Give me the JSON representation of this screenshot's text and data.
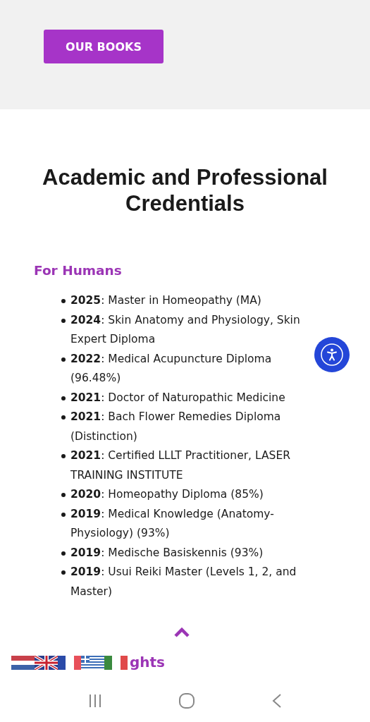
{
  "header": {
    "button": "OUR BOOKS"
  },
  "heading": "Academic and Professional Credentials",
  "section": {
    "title": "For Humans",
    "items": [
      "**2025**: Master in Homeopathy (MA)",
      "**2024**: Skin Anatomy and Physiology, Skin Expert Diploma",
      "**2022**: Medical Acupuncture Diploma (96.48%)",
      "**2021**: Doctor of Naturopathic Medicine",
      "**2021**: Bach Flower Remedies Diploma (Distinction)",
      "**2021**: Certified LLLT Practitioner, LASER TRAINING INSTITUTE",
      "**2020**: Homeopathy Diploma (85%)",
      "**2019**: Medical Knowledge (Anatomy-Physiology) (93%)",
      "**2019**: Medische Basiskennis (93%)",
      "**2019**: Usui Reiki Master (Levels 1, 2, and Master)"
    ]
  },
  "footer": {
    "partial_text": "ghts",
    "flags": [
      {
        "kind": "nl"
      },
      {
        "kind": "uk"
      },
      {
        "kind": "fr"
      },
      {
        "kind": "gr"
      },
      {
        "kind": "it"
      }
    ]
  }
}
